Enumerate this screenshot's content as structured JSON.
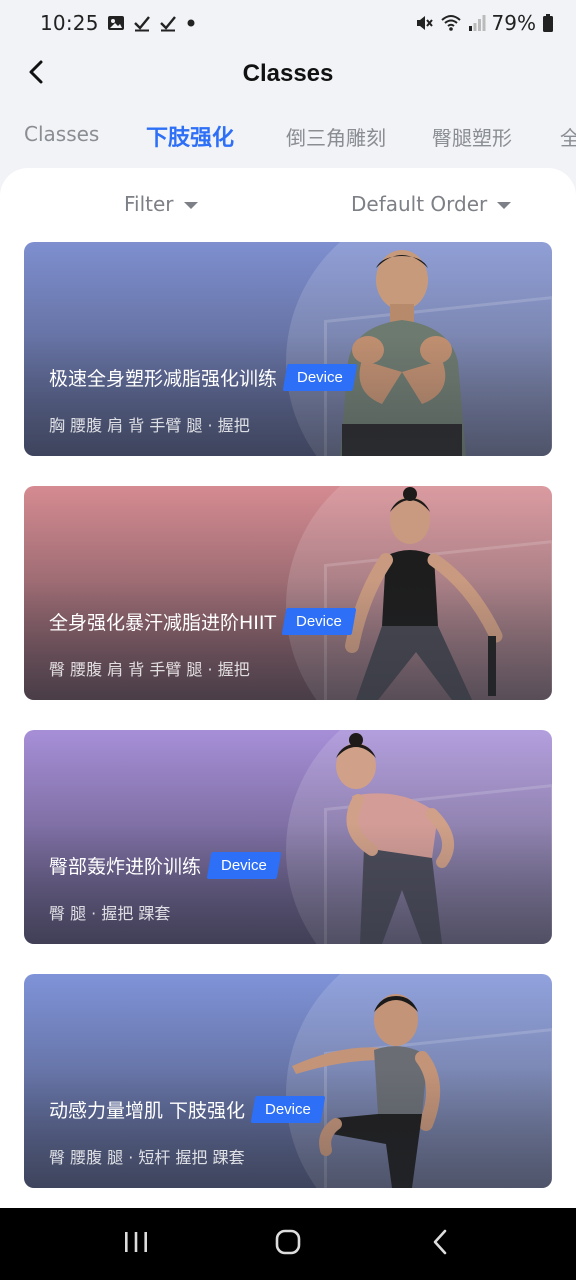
{
  "status_bar": {
    "time": "10:25",
    "left_icons": [
      "image-icon",
      "check-icon",
      "check-icon",
      "dot-icon"
    ],
    "battery_percent": "79%",
    "right_icons": [
      "mute-icon",
      "wifi-icon",
      "signal-icon",
      "battery-icon"
    ]
  },
  "header": {
    "title": "Classes",
    "back_icon": "chevron-left-icon"
  },
  "tabs": [
    {
      "label": "Classes",
      "active": false
    },
    {
      "label": "下肢强化",
      "active": true
    },
    {
      "label": "倒三角雕刻",
      "active": false
    },
    {
      "label": "臀腿塑形",
      "active": false
    },
    {
      "label": "全",
      "active": false
    }
  ],
  "filters": {
    "filter_label": "Filter",
    "order_label": "Default Order"
  },
  "cards": [
    {
      "title": "极速全身塑形减脂强化训练",
      "badge": "Device",
      "tags": "胸 腰腹 肩 背 手臂 腿 · 握把",
      "bg_top": "#7e8fd0",
      "bg_bottom": "#4a5170"
    },
    {
      "title": "全身强化暴汗减脂进阶HIIT",
      "badge": "Device",
      "tags": "臀 腰腹 肩 背 手臂 腿 · 握把",
      "bg_top": "#d58b91",
      "bg_bottom": "#5b4650"
    },
    {
      "title": "臀部轰炸进阶训练",
      "badge": "Device",
      "tags": "臀 腿 · 握把 踝套",
      "bg_top": "#a78fd8",
      "bg_bottom": "#4e4966"
    },
    {
      "title": "动感力量增肌 下肢强化",
      "badge": "Device",
      "tags": "臀 腰腹 腿 · 短杆 握把 踝套",
      "bg_top": "#7f93d8",
      "bg_bottom": "#4a5170"
    }
  ],
  "nav_bar": {
    "recents_icon": "recents-icon",
    "home_icon": "home-icon",
    "back_icon": "back-icon"
  }
}
